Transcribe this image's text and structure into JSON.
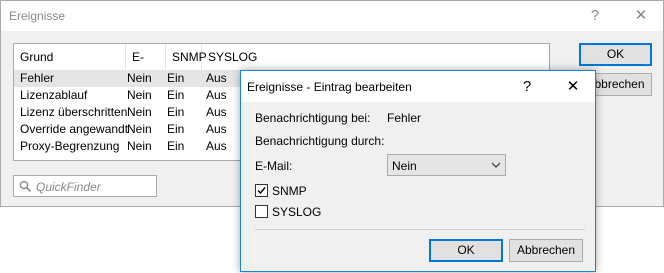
{
  "main_window": {
    "title": "Ereignisse",
    "help_label": "?",
    "close_label": "✕",
    "columns": [
      "Grund",
      "E-Mail",
      "SNMP",
      "SYSLOG"
    ],
    "rows": [
      {
        "grund": "Fehler",
        "email": "Nein",
        "snmp": "Ein",
        "syslog": "Aus"
      },
      {
        "grund": "Lizenzablauf",
        "email": "Nein",
        "snmp": "Ein",
        "syslog": "Aus"
      },
      {
        "grund": "Lizenz überschritten",
        "email": "Nein",
        "snmp": "Ein",
        "syslog": "Aus"
      },
      {
        "grund": "Override angewandt",
        "email": "Nein",
        "snmp": "Ein",
        "syslog": "Aus"
      },
      {
        "grund": "Proxy-Begrenzung",
        "email": "Nein",
        "snmp": "Ein",
        "syslog": "Aus"
      }
    ],
    "ok_label": "OK",
    "cancel_label": "Abbrechen",
    "quickfinder_placeholder": "QuickFinder"
  },
  "dialog": {
    "title": "Ereignisse - Eintrag bearbeiten",
    "help_label": "?",
    "close_label": "✕",
    "notify_on_label": "Benachrichtigung bei:",
    "notify_on_value": "Fehler",
    "notify_via_label": "Benachrichtigung durch:",
    "email_label": "E-Mail:",
    "email_value": "Nein",
    "snmp_label": "SNMP",
    "snmp_checked": true,
    "syslog_label": "SYSLOG",
    "syslog_checked": false,
    "ok_label": "OK",
    "cancel_label": "Abbrechen"
  }
}
